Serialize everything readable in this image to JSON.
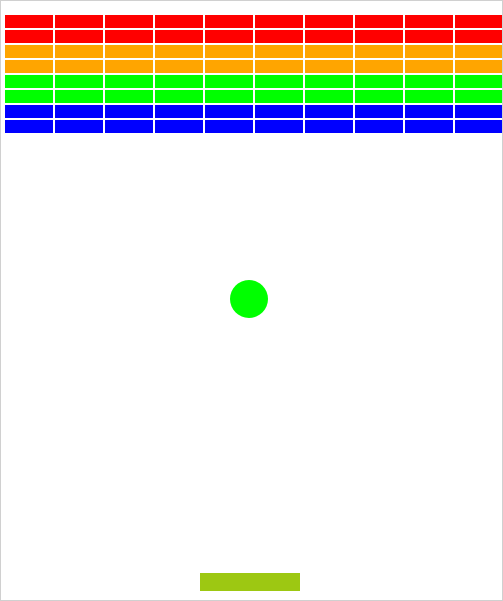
{
  "game": {
    "bricks": {
      "columns": 10,
      "row_colors": [
        "#ff0000",
        "#ff0000",
        "#ffa500",
        "#ffa500",
        "#00ff00",
        "#00ff00",
        "#0000ff",
        "#0000ff"
      ]
    },
    "ball": {
      "color": "#00ff00"
    },
    "paddle": {
      "color": "#9dc812"
    },
    "background_color": "#ffffff"
  }
}
